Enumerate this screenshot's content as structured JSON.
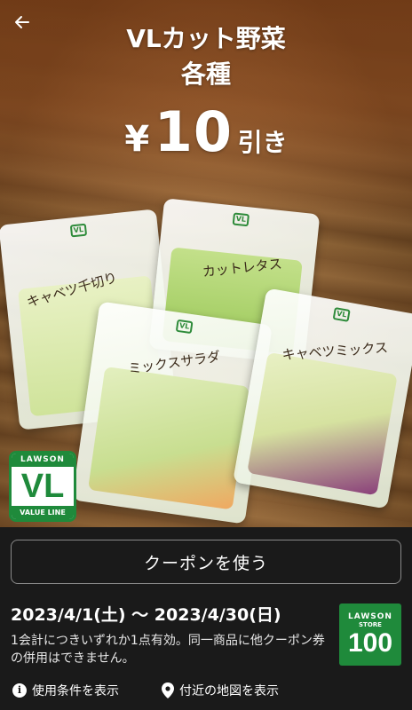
{
  "hero": {
    "title_line1": "VLカット野菜",
    "title_line2": "各種",
    "discount_yen": "¥",
    "discount_amount": "10",
    "discount_suffix": "引き",
    "packages": [
      {
        "label": "キャベツ千切り"
      },
      {
        "label": "カットレタス"
      },
      {
        "label": "ミックスサラダ"
      },
      {
        "label": "キャベツミックス"
      }
    ],
    "vl_logo": {
      "top": "LAWSON",
      "mid": "VL",
      "bottom": "VALUE LINE"
    }
  },
  "panel": {
    "coupon_button_label": "クーポンを使う",
    "date_range": "2023/4/1(土) 〜 2023/4/30(日)",
    "terms": "1会計につきいずれか1点有効。同一商品に他クーポン券の併用はできません。",
    "store_logo": {
      "line1": "LAWSON",
      "line2": "STORE",
      "line3": "100"
    },
    "links": {
      "conditions": "使用条件を表示",
      "map": "付近の地図を表示"
    }
  },
  "icons": {
    "back": "arrow-left-icon",
    "info": "info-icon",
    "location": "map-pin-icon"
  },
  "colors": {
    "brand_green": "#1f8a3b",
    "hero_orange": "#a25a26",
    "panel_bg": "#1a1a1a"
  }
}
